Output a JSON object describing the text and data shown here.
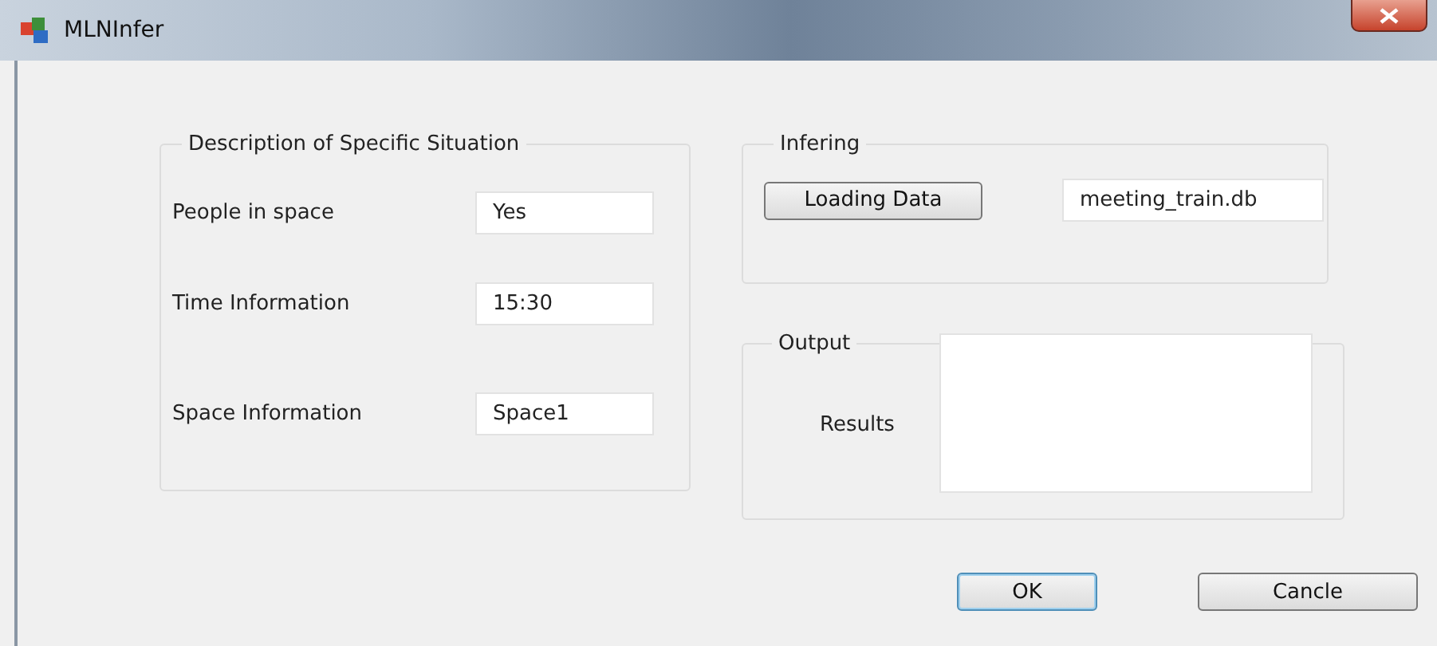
{
  "window": {
    "title": "MLNInfer"
  },
  "situation": {
    "legend": "Description of Specific Situation",
    "fields": [
      {
        "label": "People in space",
        "value": "Yes"
      },
      {
        "label": "Time Information",
        "value": "15:30"
      },
      {
        "label": "Space Information",
        "value": "Space1"
      }
    ]
  },
  "infering": {
    "legend": "Infering",
    "button": "Loading Data",
    "value": "meeting_train.db"
  },
  "output": {
    "legend": "Output",
    "label": "Results"
  },
  "buttons": [
    {
      "label": "OK",
      "default": true
    },
    {
      "label": "Cancle",
      "default": false
    }
  ]
}
